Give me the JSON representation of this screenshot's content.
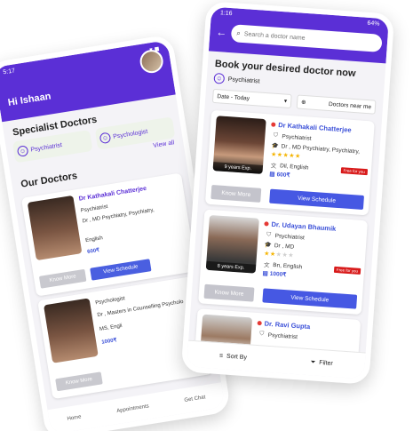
{
  "back_phone": {
    "status_time": "5:17",
    "greeting": "Hi Ishaan",
    "section_specialist": "Specialist Doctors",
    "specialities": [
      "Psychiatrist",
      "Psychologist"
    ],
    "view_all": "View all",
    "section_our": "Our Doctors",
    "doctors": [
      {
        "name": "Dr Kathakali  Chatterjee",
        "speciality": "Psychiatrist",
        "degree": "Dr , MD Psychiatry, Psychiatry,",
        "language": "English",
        "fee": "600₹",
        "photo_caption": "9 years Exp.",
        "more": "Know More",
        "schedule": "View Schedule"
      },
      {
        "name": "",
        "speciality": "Psychologist",
        "degree": "Dr , Masters in Counselling Psycholo",
        "language": "MS, Engli",
        "fee": "1000₹",
        "photo_caption": "Experience",
        "more": "Know More"
      }
    ],
    "nav": [
      "Home",
      "Appointments",
      "Get Chat"
    ]
  },
  "front_phone": {
    "status_time": "1:16",
    "status_battery": "64%",
    "search_placeholder": "Search a doctor name",
    "title": "Book your desired doctor now",
    "chip": "Psychiatrist",
    "filter_date": "Date - Today",
    "filter_near": "Doctors near me",
    "doctors": [
      {
        "name": "Dr Kathakali  Chatterjee",
        "speciality": "Psychiatrist",
        "degree": "Dr , MD Psychiatry, Psychiatry,",
        "language": "Dil, English",
        "fee": "600₹",
        "exp": "9 years Exp.",
        "rating": 5,
        "badge": "Free for you",
        "more": "Know More",
        "schedule": "View Schedule"
      },
      {
        "name": "Dr. Udayan Bhaumik",
        "speciality": "Psychiatrist",
        "degree": "Dr , MD",
        "language": "Bn, English",
        "fee": "1000₹",
        "exp": "8 years Exp.",
        "rating": 2,
        "badge": "Free for you",
        "more": "Know More",
        "schedule": "View Schedule"
      },
      {
        "name": "Dr. Ravi Gupta",
        "speciality": "Psychiatrist"
      }
    ],
    "sort_label": "Sort By",
    "filter_label": "Filter"
  },
  "colors": {
    "primary": "#5b2fd6",
    "button_blue": "#4658e3",
    "star": "#f5b400",
    "badge_red": "#d81b1b"
  }
}
